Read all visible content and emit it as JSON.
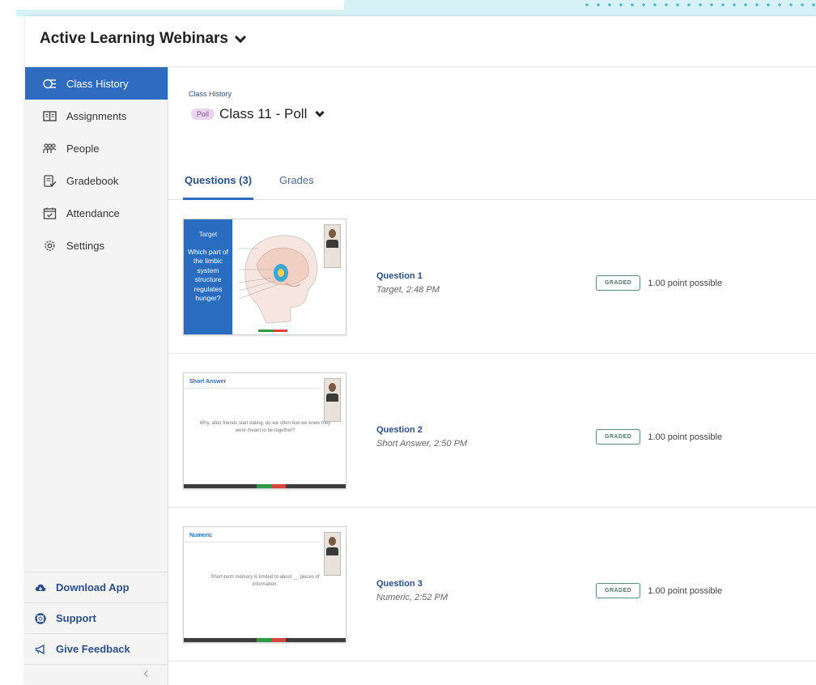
{
  "course": {
    "title": "Active Learning Webinars"
  },
  "sidebar": {
    "items": [
      {
        "label": "Class History",
        "icon": "history-icon",
        "active": true
      },
      {
        "label": "Assignments",
        "icon": "book-icon",
        "active": false
      },
      {
        "label": "People",
        "icon": "people-icon",
        "active": false
      },
      {
        "label": "Gradebook",
        "icon": "gradebook-icon",
        "active": false
      },
      {
        "label": "Attendance",
        "icon": "calendar-icon",
        "active": false
      },
      {
        "label": "Settings",
        "icon": "gear-icon",
        "active": false
      }
    ],
    "bottom": [
      {
        "label": "Download App",
        "icon": "cloud-icon"
      },
      {
        "label": "Support",
        "icon": "lifebuoy-icon"
      },
      {
        "label": "Give Feedback",
        "icon": "megaphone-icon"
      }
    ]
  },
  "main": {
    "breadcrumb": "Class History",
    "chip": "Poll",
    "class_title": "Class 11 - Poll",
    "tabs": [
      {
        "label": "Questions (3)",
        "active": true
      },
      {
        "label": "Grades",
        "active": false
      }
    ],
    "questions": [
      {
        "title": "Question 1",
        "subtitle": "Target, 2:48 PM",
        "badge": "GRADED",
        "points": "1.00 point possible",
        "thumb": {
          "label": "Target",
          "text": "Which part of the limbic system structure regulates hunger?"
        }
      },
      {
        "title": "Question 2",
        "subtitle": "Short Answer, 2:50 PM",
        "badge": "GRADED",
        "points": "1.00 point possible",
        "thumb": {
          "label": "Short Answer",
          "text": "Why, after friends start dating, do we often feel we knew they were meant to be together?"
        }
      },
      {
        "title": "Question 3",
        "subtitle": "Numeric, 2:52 PM",
        "badge": "GRADED",
        "points": "1.00 point possible",
        "thumb": {
          "label": "Numeric",
          "text": "Short-term memory is limited to about __ pieces of information."
        }
      }
    ]
  },
  "colors": {
    "accent": "#2f6cc0",
    "link": "#2a4f8a",
    "chip_bg": "#e7d6ee",
    "badge": "#4f7a66"
  }
}
